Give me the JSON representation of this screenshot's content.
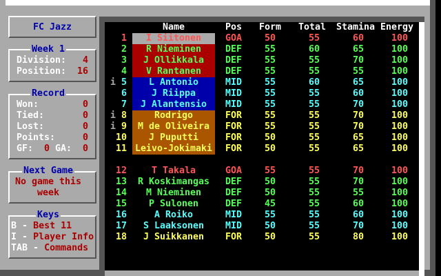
{
  "team_name": "FC Jazz",
  "week_panel": {
    "title": "Week 1",
    "division_label": "Division:",
    "division": "4",
    "position_label": "Position:",
    "position": "16"
  },
  "record_panel": {
    "title": "Record",
    "won_label": "Won:",
    "won": "0",
    "tied_label": "Tied:",
    "tied": "0",
    "lost_label": "Lost:",
    "lost": "0",
    "points_label": "Points:",
    "points": "0",
    "gf_label": "GF:",
    "gf": "0",
    "ga_label": "GA:",
    "ga": "0"
  },
  "next_game_panel": {
    "title": "Next Game",
    "line1": "No game this",
    "line2": "week"
  },
  "keys_panel": {
    "title": "Keys",
    "keys": [
      {
        "key": "B",
        "sep": "-",
        "action": "Best 11"
      },
      {
        "key": "I",
        "sep": "-",
        "action": "Player Info"
      },
      {
        "key": "TAB",
        "sep": "-",
        "action": "Commands"
      }
    ]
  },
  "table": {
    "headers": {
      "name": "Name",
      "pos": "Pos",
      "form": "Form",
      "total": "Total",
      "stamina": "Stamina",
      "energy": "Energy"
    },
    "position_colors": {
      "GOA": {
        "text": "#ff5555",
        "bg": "#aaaaaa"
      },
      "DEF": {
        "text": "#55ff55",
        "bg": "#aa0000"
      },
      "MID": {
        "text": "#55ffff",
        "bg": "#0000aa"
      },
      "FOR": {
        "text": "#ffff55",
        "bg": "#aa5500"
      }
    },
    "players": [
      {
        "info": "",
        "num": "1",
        "name": "I Siitonen",
        "pos": "GOA",
        "form": "50",
        "total": "55",
        "stamina": "60",
        "energy": "100",
        "selected": true
      },
      {
        "info": "",
        "num": "2",
        "name": "R Nieminen",
        "pos": "DEF",
        "form": "55",
        "total": "60",
        "stamina": "65",
        "energy": "100",
        "selected": true
      },
      {
        "info": "",
        "num": "3",
        "name": "J Ollikkala",
        "pos": "DEF",
        "form": "55",
        "total": "55",
        "stamina": "70",
        "energy": "100",
        "selected": true
      },
      {
        "info": "",
        "num": "4",
        "name": "V Rantanen",
        "pos": "DEF",
        "form": "55",
        "total": "55",
        "stamina": "55",
        "energy": "100",
        "selected": true
      },
      {
        "info": "i",
        "num": "5",
        "name": "L Antonio",
        "pos": "MID",
        "form": "55",
        "total": "60",
        "stamina": "65",
        "energy": "100",
        "selected": true
      },
      {
        "info": "",
        "num": "6",
        "name": "J Riippa",
        "pos": "MID",
        "form": "55",
        "total": "55",
        "stamina": "60",
        "energy": "100",
        "selected": true
      },
      {
        "info": "",
        "num": "7",
        "name": "J Alantensio",
        "pos": "MID",
        "form": "55",
        "total": "55",
        "stamina": "70",
        "energy": "100",
        "selected": true
      },
      {
        "info": "i",
        "num": "8",
        "name": "Rodrigo",
        "pos": "FOR",
        "form": "55",
        "total": "55",
        "stamina": "70",
        "energy": "100",
        "selected": true
      },
      {
        "info": "i",
        "num": "9",
        "name": "M de Oliveira",
        "pos": "FOR",
        "form": "55",
        "total": "55",
        "stamina": "70",
        "energy": "100",
        "selected": true
      },
      {
        "info": "",
        "num": "10",
        "name": "J Puputti",
        "pos": "FOR",
        "form": "50",
        "total": "55",
        "stamina": "65",
        "energy": "100",
        "selected": true
      },
      {
        "info": "",
        "num": "11",
        "name": "Leivo-Jokimaki",
        "pos": "FOR",
        "form": "50",
        "total": "55",
        "stamina": "65",
        "energy": "100",
        "selected": true
      },
      {
        "info": "",
        "num": "12",
        "name": "T Takala",
        "pos": "GOA",
        "form": "55",
        "total": "55",
        "stamina": "70",
        "energy": "100",
        "selected": false
      },
      {
        "info": "",
        "num": "13",
        "name": "R Koskimangas",
        "pos": "DEF",
        "form": "50",
        "total": "55",
        "stamina": "70",
        "energy": "100",
        "selected": false
      },
      {
        "info": "",
        "num": "14",
        "name": "M Nieminen",
        "pos": "DEF",
        "form": "50",
        "total": "55",
        "stamina": "55",
        "energy": "100",
        "selected": false
      },
      {
        "info": "",
        "num": "15",
        "name": "P Sulonen",
        "pos": "DEF",
        "form": "45",
        "total": "55",
        "stamina": "60",
        "energy": "100",
        "selected": false
      },
      {
        "info": "",
        "num": "16",
        "name": "A Roiko",
        "pos": "MID",
        "form": "55",
        "total": "55",
        "stamina": "60",
        "energy": "100",
        "selected": false
      },
      {
        "info": "",
        "num": "17",
        "name": "S Laaksonen",
        "pos": "MID",
        "form": "50",
        "total": "55",
        "stamina": "70",
        "energy": "100",
        "selected": false
      },
      {
        "info": "",
        "num": "18",
        "name": "J Suikkanen",
        "pos": "FOR",
        "form": "50",
        "total": "55",
        "stamina": "80",
        "energy": "100",
        "selected": false
      }
    ]
  }
}
